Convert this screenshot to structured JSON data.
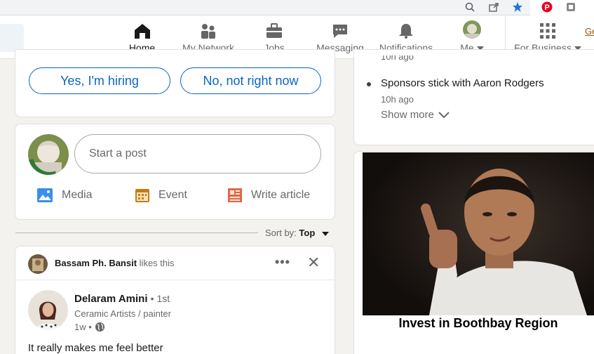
{
  "nav": {
    "items": [
      {
        "label": "Home",
        "icon": "home-icon"
      },
      {
        "label": "My Network",
        "icon": "network-icon"
      },
      {
        "label": "Jobs",
        "icon": "briefcase-icon"
      },
      {
        "label": "Messaging",
        "icon": "chat-icon"
      },
      {
        "label": "Notifications",
        "icon": "bell-icon"
      },
      {
        "label": "Me",
        "icon": "avatar"
      },
      {
        "label": "For Business",
        "icon": "grid-icon"
      }
    ],
    "overflow_link": "Ge"
  },
  "hiring": {
    "yes_label": "Yes, I'm hiring",
    "no_label": "No, not right now"
  },
  "share_box": {
    "placeholder": "Start a post",
    "actions": [
      {
        "label": "Media",
        "icon": "image-icon",
        "color": "#378fe9"
      },
      {
        "label": "Event",
        "icon": "calendar-icon",
        "color": "#c37d16"
      },
      {
        "label": "Write article",
        "icon": "article-icon",
        "color": "#e06847"
      }
    ]
  },
  "sort": {
    "prefix": "Sort by:",
    "value": "Top"
  },
  "post": {
    "liker_name": "Bassam Ph. Bansit",
    "liker_action": "likes this",
    "author_name": "Delaram Amini",
    "author_degree": "• 1st",
    "author_headline": "Ceramic Artists / painter",
    "time": "1w •",
    "text": "It really makes me feel better"
  },
  "news": {
    "partial_time": "10h ago",
    "items": [
      {
        "title": "Sponsors stick with Aaron Rodgers",
        "time": "10h ago"
      }
    ],
    "show_more": "Show more"
  },
  "ad": {
    "caption": "Invest in Boothbay Region"
  },
  "colors": {
    "accent": "#0a66c2",
    "background": "#f3f2ef"
  }
}
